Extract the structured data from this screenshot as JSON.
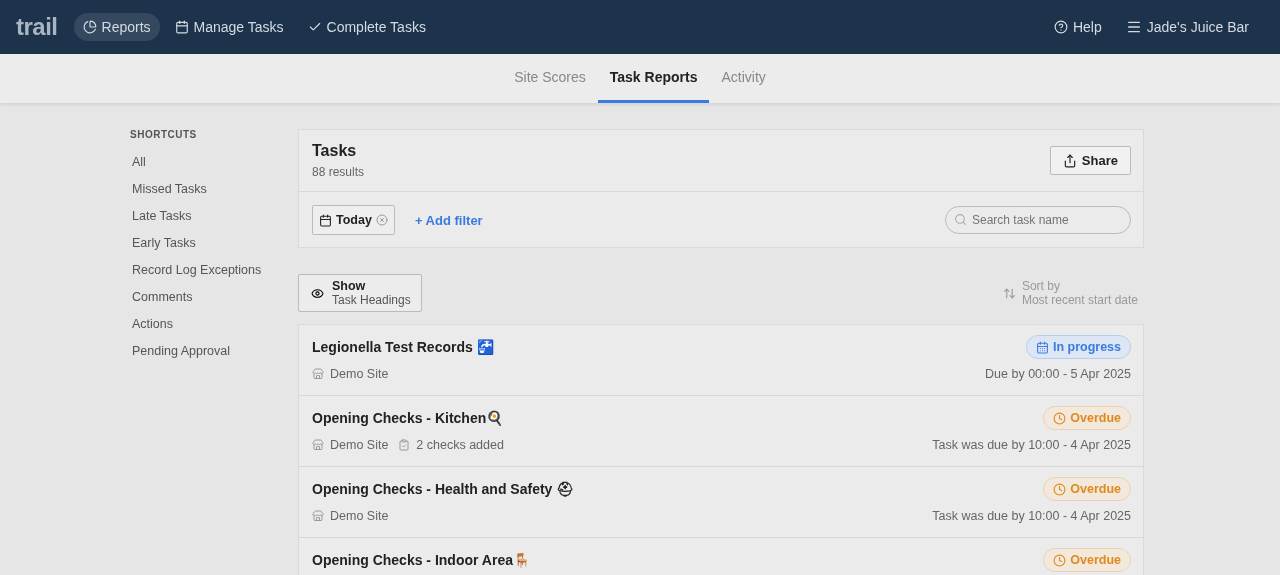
{
  "topbar": {
    "logo": "trail",
    "nav": [
      {
        "label": "Reports",
        "kind": "pie",
        "selected": true
      },
      {
        "label": "Manage Tasks",
        "kind": "calendar",
        "selected": false
      },
      {
        "label": "Complete Tasks",
        "kind": "check",
        "selected": false
      }
    ],
    "help": "Help",
    "account": "Jade's Juice Bar"
  },
  "tabs": [
    {
      "label": "Site Scores",
      "selected": false
    },
    {
      "label": "Task Reports",
      "selected": true
    },
    {
      "label": "Activity",
      "selected": false
    }
  ],
  "sidebar": {
    "heading": "SHORTCUTS",
    "items": [
      "All",
      "Missed Tasks",
      "Late Tasks",
      "Early Tasks",
      "Record Log Exceptions",
      "Comments",
      "Actions",
      "Pending Approval"
    ]
  },
  "panel": {
    "title": "Tasks",
    "count": "88 results",
    "share": "Share",
    "filter_chip": "Today",
    "add_filter": "+ Add filter",
    "search": {
      "placeholder": "Search task name"
    }
  },
  "view": {
    "show": "Show",
    "show_sub": "Task Headings",
    "sort": "Sort by",
    "sort_sub": "Most recent start date"
  },
  "tasks": [
    {
      "title": "Legionella Test Records 🚰",
      "kind": "in_progress",
      "status_label": "In progress",
      "site": "Demo Site",
      "due": "Due by 00:00 - 5 Apr 2025"
    },
    {
      "title": "Opening Checks - Kitchen🍳",
      "kind": "overdue",
      "status_label": "Overdue",
      "site": "Demo Site",
      "checks": "2 checks added",
      "due": "Task was due by 10:00 - 4 Apr 2025"
    },
    {
      "title": "Opening Checks - Health and Safety ⛑",
      "kind": "overdue",
      "status_label": "Overdue",
      "site": "Demo Site",
      "due": "Task was due by 10:00 - 4 Apr 2025"
    },
    {
      "title": "Opening Checks - Indoor Area🪑",
      "kind": "overdue",
      "status_label": "Overdue"
    }
  ]
}
